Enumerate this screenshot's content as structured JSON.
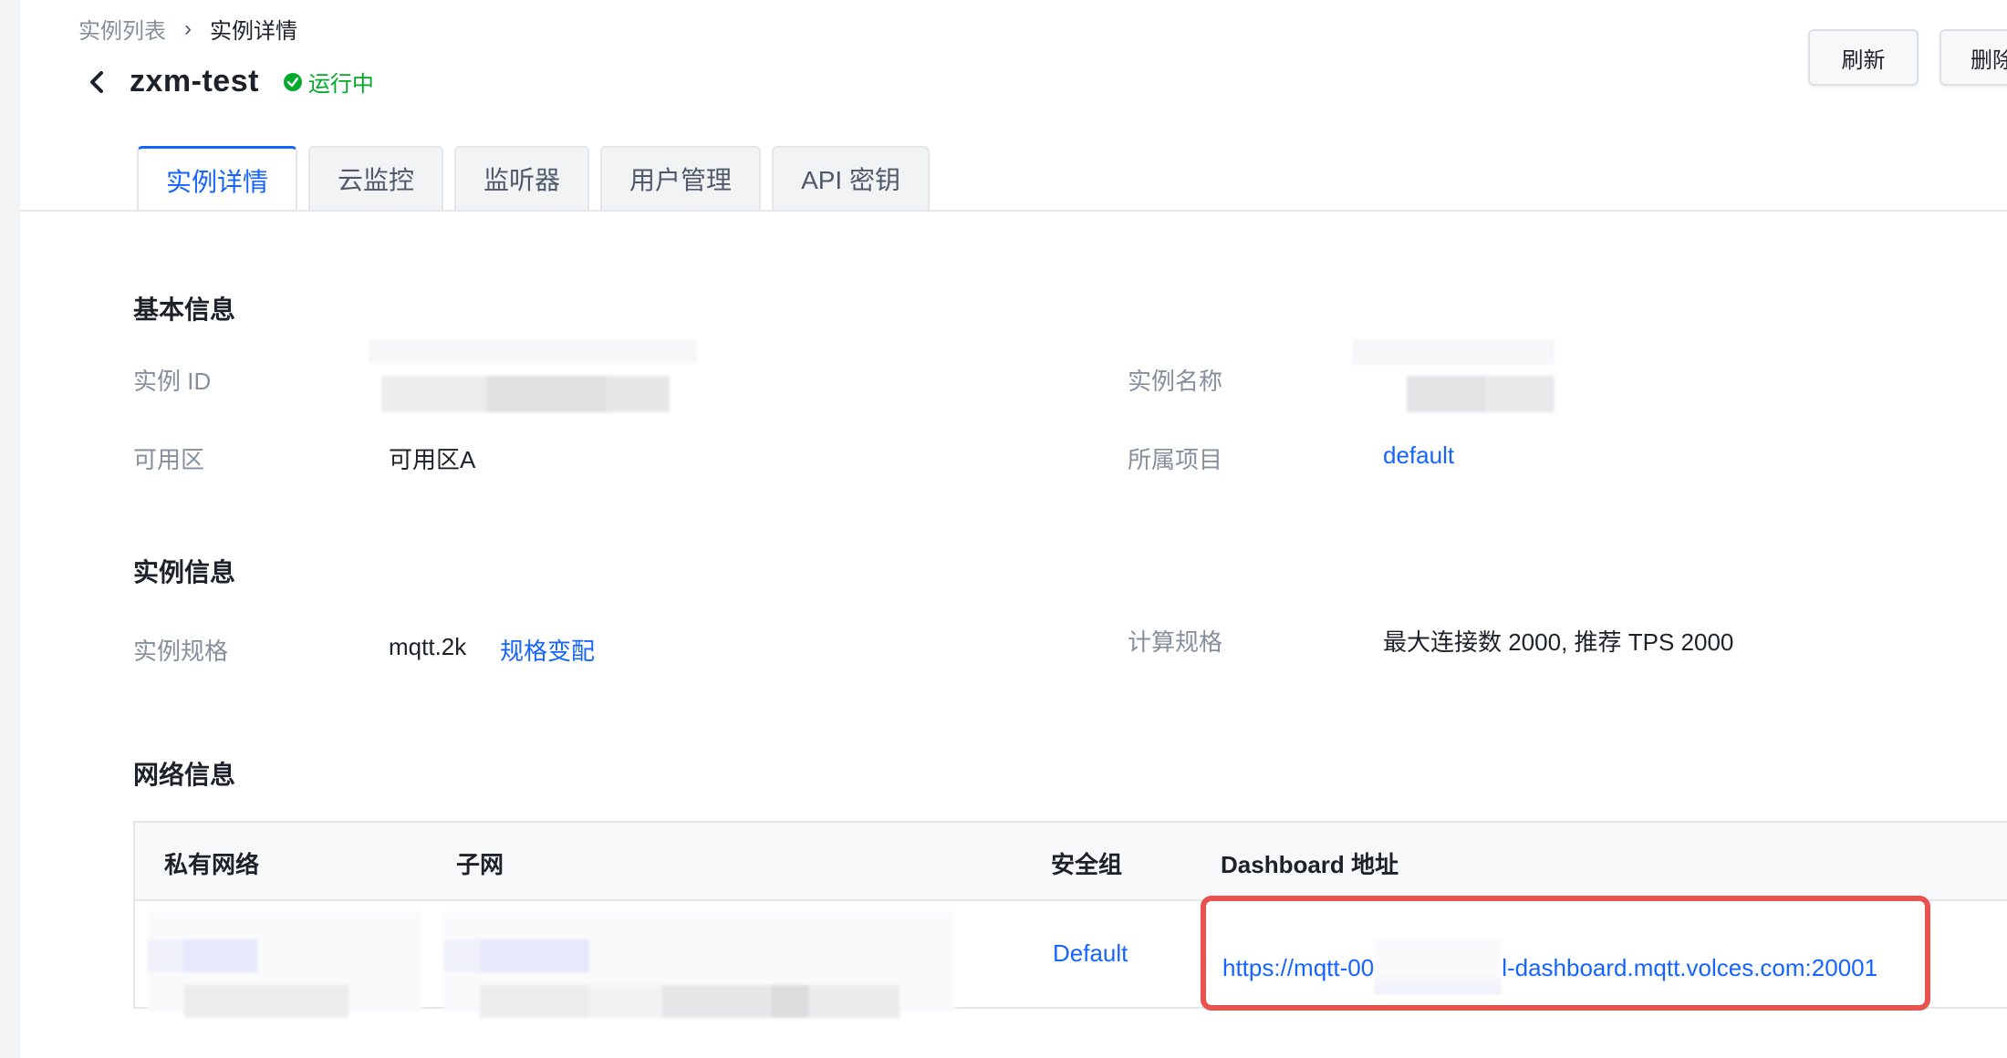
{
  "breadcrumb": {
    "parent": "实例列表",
    "separator": "›",
    "current": "实例详情"
  },
  "header": {
    "title": "zxm-test",
    "status": "运行中",
    "status_color": "#00aa2a"
  },
  "actions": {
    "refresh": "刷新",
    "delete": "删除"
  },
  "tabs": [
    {
      "label": "实例详情",
      "active": true
    },
    {
      "label": "云监控",
      "active": false
    },
    {
      "label": "监听器",
      "active": false
    },
    {
      "label": "用户管理",
      "active": false
    },
    {
      "label": "API 密钥",
      "active": false
    }
  ],
  "basic_info": {
    "title": "基本信息",
    "instance_id_label": "实例 ID",
    "instance_name_label": "实例名称",
    "zone_label": "可用区",
    "zone_value": "可用区A",
    "project_label": "所属项目",
    "project_value": "default"
  },
  "instance_info": {
    "title": "实例信息",
    "spec_label": "实例规格",
    "spec_value": "mqtt.2k",
    "spec_change": "规格变配",
    "compute_label": "计算规格",
    "compute_value": "最大连接数 2000, 推荐 TPS 2000"
  },
  "network_info": {
    "title": "网络信息",
    "columns": [
      "私有网络",
      "子网",
      "安全组",
      "Dashboard 地址"
    ],
    "row": {
      "security_group": "Default",
      "dashboard_prefix": "https://mqtt-00",
      "dashboard_suffix": "l-dashboard.mqtt.volces.com:20001"
    }
  },
  "colors": {
    "accent": "#1664ff",
    "highlight": "#e8524f",
    "success": "#00aa2a"
  },
  "icons": {
    "back": "chevron-left-icon",
    "status": "check-circle-icon",
    "breadcrumb_sep": "chevron-right-icon"
  }
}
